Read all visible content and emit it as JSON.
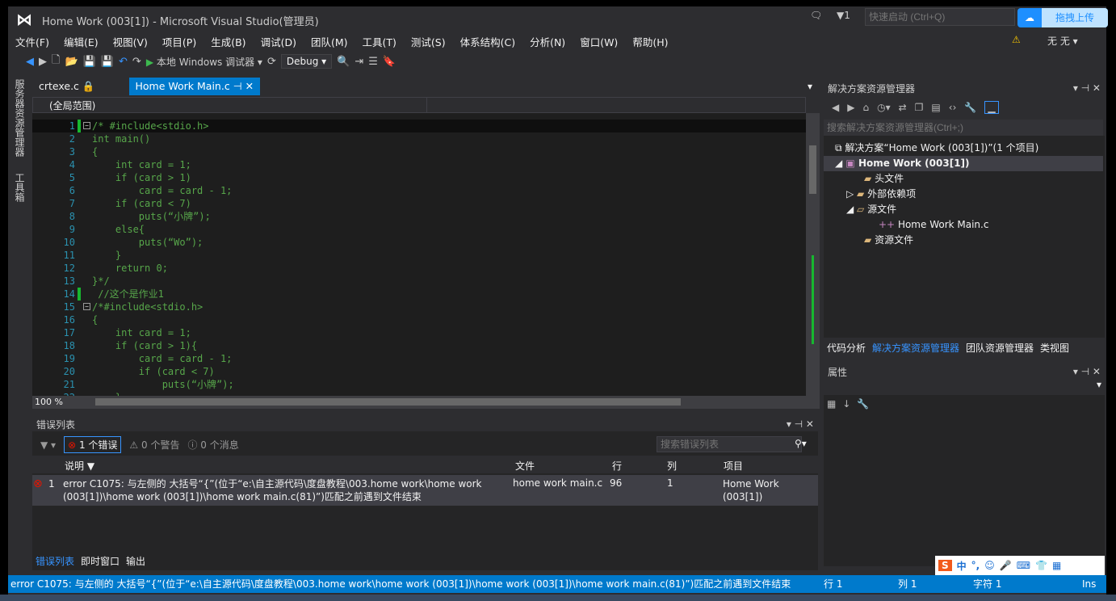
{
  "window": {
    "title": "Home Work (003[1]) - Microsoft Visual Studio(管理员)",
    "notifications": "1",
    "quick_launch_placeholder": "快速启动 (Ctrl+Q)",
    "upload_button": "拖拽上传",
    "user": "无 无"
  },
  "menu": [
    "文件(F)",
    "编辑(E)",
    "视图(V)",
    "项目(P)",
    "生成(B)",
    "调试(D)",
    "团队(M)",
    "工具(T)",
    "测试(S)",
    "体系结构(C)",
    "分析(N)",
    "窗口(W)",
    "帮助(H)"
  ],
  "toolbar": {
    "run_label": "本地 Windows 调试器",
    "config": "Debug"
  },
  "side_strip": [
    "服务器资源管理器",
    "工具箱"
  ],
  "tabs": [
    {
      "label": "crtexe.c",
      "active": false
    },
    {
      "label": "Home Work Main.c",
      "active": true
    }
  ],
  "editor": {
    "scope": "(全局范围)",
    "zoom": "100 %",
    "lines": [
      "/* #include<stdio.h>",
      "int main()",
      "{",
      "    int card = 1;",
      "    if (card > 1)",
      "        card = card - 1;",
      "    if (card < 7)",
      "        puts(“小牌”);",
      "    else{",
      "        puts(“Wo”);",
      "    }",
      "    return 0;",
      "}*/",
      " //这个是作业1",
      "/*#include<stdio.h>",
      "{",
      "    int card = 1;",
      "    if (card > 1){",
      "        card = card - 1;",
      "        if (card < 7)",
      "            puts(“小牌”);",
      "    }"
    ]
  },
  "error_list": {
    "title": "错误列表",
    "errors_btn": "1 个错误",
    "warnings_btn": "0 个警告",
    "messages_btn": "0 个消息",
    "search_placeholder": "搜索错误列表",
    "columns": [
      "说明",
      "文件",
      "行",
      "列",
      "项目"
    ],
    "rows": [
      {
        "num": "1",
        "desc": "error C1075: 与左侧的 大括号“{”(位于“e:\\自主源代码\\度盘教程\\003.home work\\home work (003[1])\\home work (003[1])\\home work main.c(81)”)匹配之前遇到文件结束",
        "file": "home work main.c",
        "line": "96",
        "col": "1",
        "project": "Home Work (003[1])"
      }
    ],
    "bottom_tabs": [
      "错误列表",
      "即时窗口",
      "输出"
    ]
  },
  "solution_explorer": {
    "title": "解决方案资源管理器",
    "search_placeholder": "搜索解决方案资源管理器(Ctrl+;)",
    "tree": [
      "解决方案“Home Work (003[1])”(1 个项目)",
      "Home Work (003[1])",
      "头文件",
      "外部依赖项",
      "源文件",
      "Home Work Main.c",
      "资源文件"
    ],
    "tabs": [
      "代码分析",
      "解决方案资源管理器",
      "团队资源管理器",
      "类视图"
    ]
  },
  "properties": {
    "title": "属性"
  },
  "ime": {
    "mode": "中"
  },
  "status": {
    "message": "error C1075: 与左侧的 大括号“{”(位于“e:\\自主源代码\\度盘教程\\003.home work\\home work (003[1])\\home work (003[1])\\home work main.c(81)”)匹配之前遇到文件结束",
    "row": "行 1",
    "col": "列 1",
    "char": "字符 1",
    "mode": "Ins"
  },
  "colors": {
    "accent": "#007acc",
    "background": "#2d2d30",
    "editor": "#1e1e1e",
    "comment": "#57a64a",
    "line_number": "#2b91af"
  }
}
